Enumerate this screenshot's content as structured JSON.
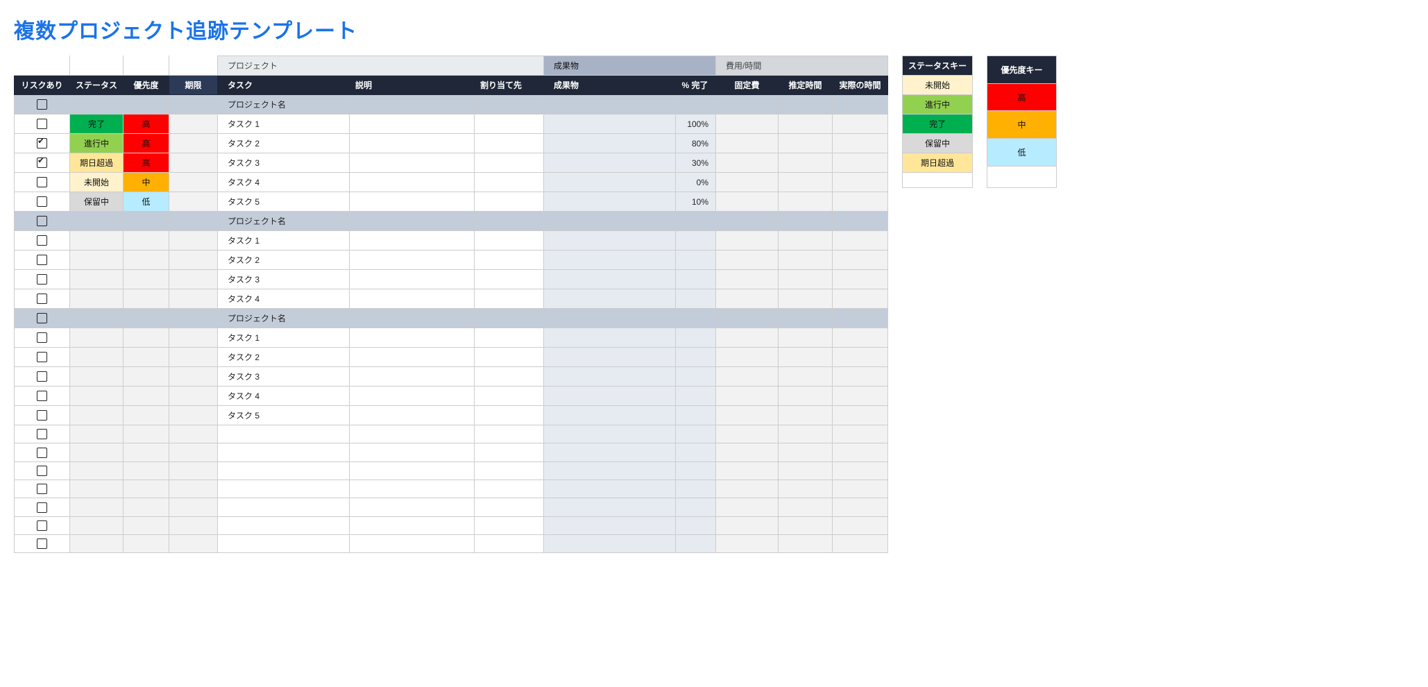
{
  "title": "複数プロジェクト追跡テンプレート",
  "group_headers": {
    "project": "プロジェクト",
    "deliverables": "成果物",
    "cost": "費用/時間"
  },
  "columns": {
    "risk": "リスクあり",
    "status": "ステータス",
    "priority": "優先度",
    "due": "期限",
    "task": "タスク",
    "desc": "説明",
    "assigned": "割り当て先",
    "deliv": "成果物",
    "pct": "% 完了",
    "fixed": "固定費",
    "est": "推定時間",
    "act": "実際の時間"
  },
  "project_label": "プロジェクト名",
  "status_values": {
    "done": "完了",
    "inprogress": "進行中",
    "overdue": "期日超過",
    "notstarted": "未開始",
    "onhold": "保留中"
  },
  "priority_values": {
    "high": "高",
    "med": "中",
    "low": "低"
  },
  "rows": [
    {
      "type": "project"
    },
    {
      "type": "task",
      "risk": false,
      "status": "done",
      "priority": "high",
      "task": "タスク 1",
      "pct": "100%"
    },
    {
      "type": "task",
      "risk": true,
      "status": "inprogress",
      "priority": "high",
      "task": "タスク 2",
      "pct": "80%"
    },
    {
      "type": "task",
      "risk": true,
      "status": "overdue",
      "priority": "high",
      "task": "タスク 3",
      "pct": "30%"
    },
    {
      "type": "task",
      "risk": false,
      "status": "notstarted",
      "priority": "med",
      "task": "タスク 4",
      "pct": "0%"
    },
    {
      "type": "task",
      "risk": false,
      "status": "onhold",
      "priority": "low",
      "task": "タスク 5",
      "pct": "10%"
    },
    {
      "type": "project"
    },
    {
      "type": "task",
      "risk": false,
      "task": "タスク 1"
    },
    {
      "type": "task",
      "risk": false,
      "task": "タスク 2"
    },
    {
      "type": "task",
      "risk": false,
      "task": "タスク 3"
    },
    {
      "type": "task",
      "risk": false,
      "task": "タスク 4"
    },
    {
      "type": "project"
    },
    {
      "type": "task",
      "risk": false,
      "task": "タスク 1"
    },
    {
      "type": "task",
      "risk": false,
      "task": "タスク 2"
    },
    {
      "type": "task",
      "risk": false,
      "task": "タスク 3"
    },
    {
      "type": "task",
      "risk": false,
      "task": "タスク 4"
    },
    {
      "type": "task",
      "risk": false,
      "task": "タスク 5"
    },
    {
      "type": "task",
      "risk": false
    },
    {
      "type": "task",
      "risk": false
    },
    {
      "type": "task",
      "risk": false
    },
    {
      "type": "task",
      "risk": false
    },
    {
      "type": "task",
      "risk": false
    },
    {
      "type": "task",
      "risk": false
    },
    {
      "type": "task",
      "risk": false
    }
  ],
  "legend_status": {
    "title": "ステータスキー",
    "items": [
      "notstarted",
      "inprogress",
      "done",
      "onhold",
      "overdue"
    ]
  },
  "legend_priority": {
    "title": "優先度キー",
    "items": [
      "high",
      "med",
      "low"
    ]
  }
}
